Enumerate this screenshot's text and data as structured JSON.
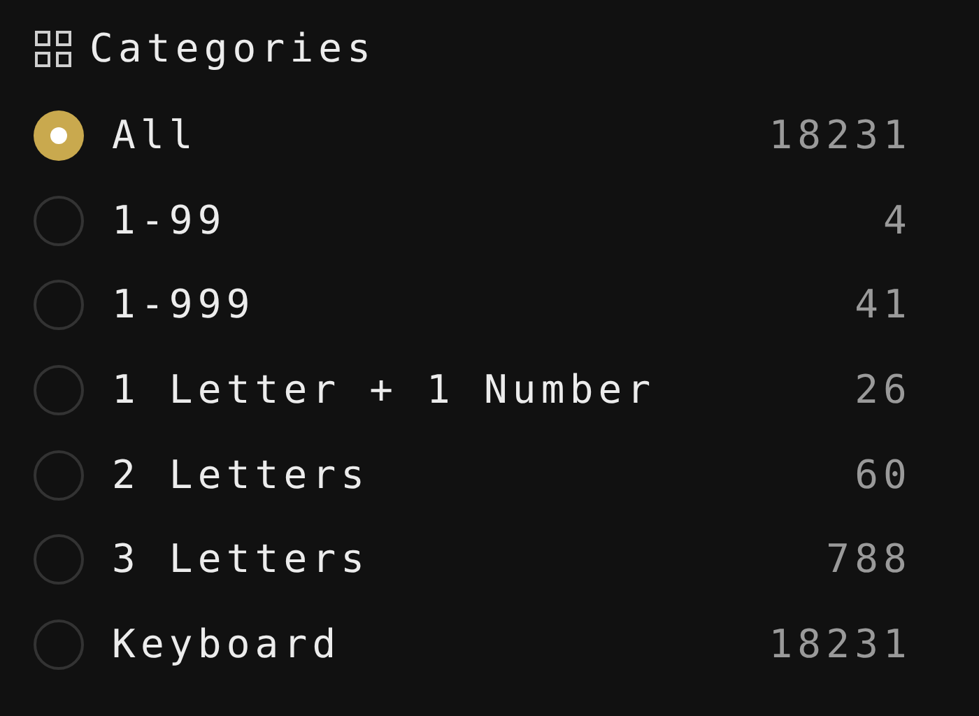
{
  "header": {
    "title": "Categories"
  },
  "categories": [
    {
      "label": "All",
      "count": "18231",
      "selected": true
    },
    {
      "label": "1-99",
      "count": "4",
      "selected": false
    },
    {
      "label": "1-999",
      "count": "41",
      "selected": false
    },
    {
      "label": "1 Letter + 1 Number",
      "count": "26",
      "selected": false
    },
    {
      "label": "2 Letters",
      "count": "60",
      "selected": false
    },
    {
      "label": "3 Letters",
      "count": "788",
      "selected": false
    },
    {
      "label": "Keyboard",
      "count": "18231",
      "selected": false
    }
  ]
}
